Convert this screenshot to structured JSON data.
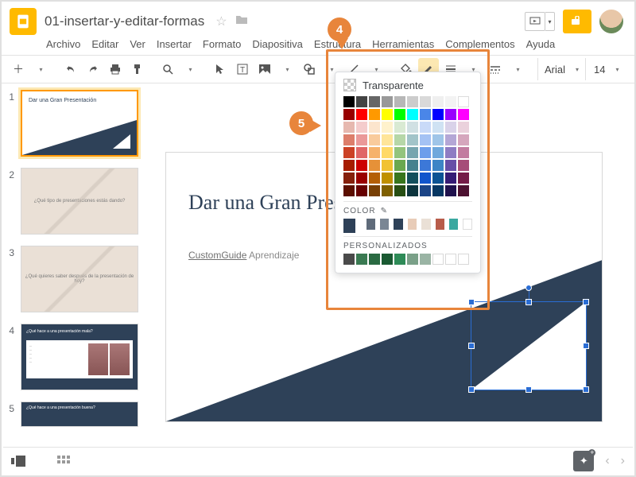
{
  "doc": {
    "title": "01-insertar-y-editar-formas"
  },
  "menu": {
    "archivo": "Archivo",
    "editar": "Editar",
    "ver": "Ver",
    "insertar": "Insertar",
    "formato": "Formato",
    "diapositiva": "Diapositiva",
    "estructura": "Estructura",
    "herramientas": "Herramientas",
    "complementos": "Complementos",
    "ayuda": "Ayuda"
  },
  "toolbar": {
    "font": "Arial",
    "size": "14"
  },
  "thumbs": {
    "t1_title": "Dar una Gran Presentación",
    "t1_sub": "",
    "t2": "¿Qué tipo de presentaciones estás dando?",
    "t3": "¿Qué quieres saber después de la presentación de hoy?",
    "t4": "¿Qué hace a una presentación mala?",
    "t5": "¿Qué hace a una presentación buena?"
  },
  "slide": {
    "title": "Dar una Gran Presentación",
    "sub_link": "CustomGuide",
    "sub_rest": " Aprendizaje"
  },
  "picker": {
    "transparent": "Transparente",
    "color_label": "COLOR",
    "custom_label": "PERSONALIZADOS",
    "main_rows": [
      [
        "#000000",
        "#434343",
        "#666666",
        "#999999",
        "#b7b7b7",
        "#cccccc",
        "#d9d9d9",
        "#efefef",
        "#f3f3f3",
        "#ffffff"
      ],
      [
        "#980000",
        "#ff0000",
        "#ff9900",
        "#ffff00",
        "#00ff00",
        "#00ffff",
        "#4a86e8",
        "#0000ff",
        "#9900ff",
        "#ff00ff"
      ],
      [
        "#e6b8af",
        "#f4cccc",
        "#fce5cd",
        "#fff2cc",
        "#d9ead3",
        "#d0e0e3",
        "#c9daf8",
        "#cfe2f3",
        "#d9d2e9",
        "#ead1dc"
      ],
      [
        "#dd7e6b",
        "#ea9999",
        "#f9cb9c",
        "#ffe599",
        "#b6d7a8",
        "#a2c4c9",
        "#a4c2f4",
        "#9fc5e8",
        "#b4a7d6",
        "#d5a6bd"
      ],
      [
        "#cc4125",
        "#e06666",
        "#f6b26b",
        "#ffd966",
        "#93c47d",
        "#76a5af",
        "#6d9eeb",
        "#6fa8dc",
        "#8e7cc3",
        "#c27ba0"
      ],
      [
        "#a61c00",
        "#cc0000",
        "#e69138",
        "#f1c232",
        "#6aa84f",
        "#45818e",
        "#3c78d8",
        "#3d85c6",
        "#674ea7",
        "#a64d79"
      ],
      [
        "#85200c",
        "#990000",
        "#b45f06",
        "#bf9000",
        "#38761d",
        "#134f5c",
        "#1155cc",
        "#0b5394",
        "#351c75",
        "#741b47"
      ],
      [
        "#5b0f00",
        "#660000",
        "#783f04",
        "#7f6000",
        "#274e13",
        "#0c343d",
        "#1c4587",
        "#073763",
        "#20124d",
        "#4c1130"
      ]
    ],
    "theme": [
      "#2e4158",
      "#5f6b7a",
      "#7a8694",
      "#2e4158",
      "#e8ccb8",
      "#eae0d6",
      "#b85c4a",
      "#3aa8a0",
      "#ffffff"
    ],
    "custom": [
      "#4a4a4a",
      "#3a7a52",
      "#2a6a42",
      "#1a5a32",
      "#2e8b57",
      "#7aa088",
      "#9ab4a4",
      "",
      "",
      ""
    ]
  },
  "badges": {
    "b4": "4",
    "b5": "5"
  }
}
